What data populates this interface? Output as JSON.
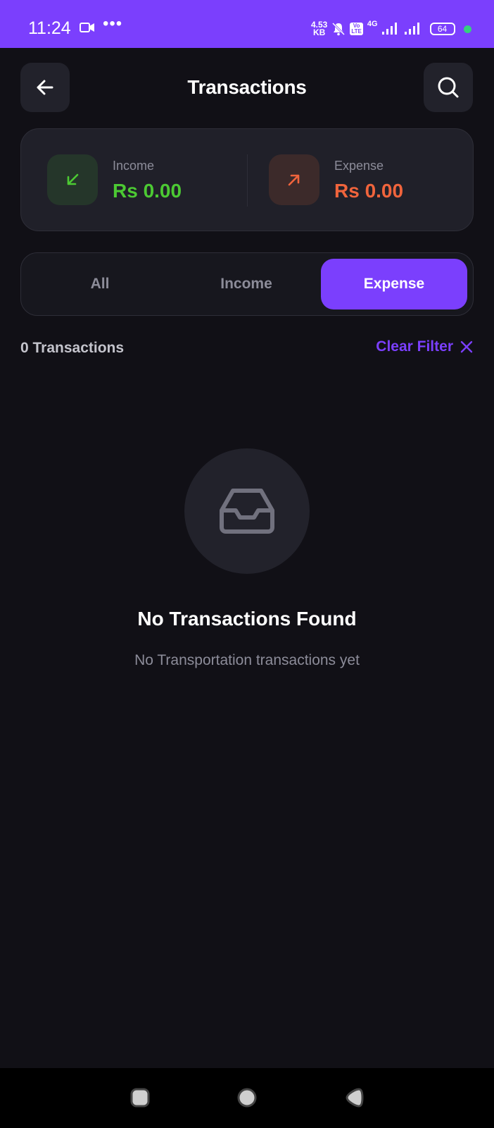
{
  "status_bar": {
    "time": "11:24",
    "more": "•••",
    "net_speed_value": "4.53",
    "net_speed_unit": "KB",
    "volte_top": "Vo",
    "volte_bottom": "LTE",
    "network": "4G",
    "battery": "64",
    "colors": {
      "background": "#7b3ffd",
      "notification_dot": "#35d07f"
    }
  },
  "header": {
    "title": "Transactions",
    "back_icon": "arrow-left-icon",
    "search_icon": "search-icon"
  },
  "summary": {
    "income": {
      "label": "Income",
      "amount": "Rs 0.00",
      "color": "#4cc933",
      "icon": "arrow-down-left-icon"
    },
    "expense": {
      "label": "Expense",
      "amount": "Rs 0.00",
      "color": "#f0643c",
      "icon": "arrow-up-right-icon"
    }
  },
  "filter_tabs": {
    "all": "All",
    "income": "Income",
    "expense": "Expense",
    "selected": "Expense",
    "accent": "#7b3ffd"
  },
  "list": {
    "count_label": "0 Transactions",
    "clear_filter": "Clear Filter"
  },
  "empty_state": {
    "icon": "inbox-icon",
    "title": "No Transactions Found",
    "subtitle": "No Transportation transactions yet"
  },
  "nav_bar": {
    "recent_icon": "recent-apps-icon",
    "home_icon": "home-icon",
    "back_icon": "back-triangle-icon"
  }
}
